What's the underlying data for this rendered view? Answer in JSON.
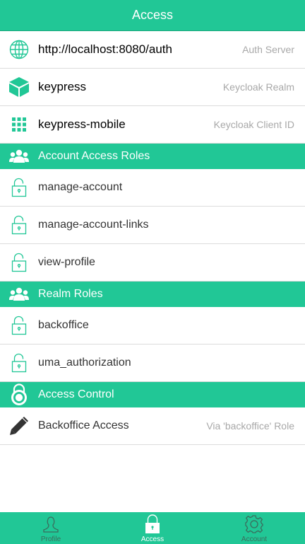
{
  "navbar": {
    "title": "Access"
  },
  "server": {
    "value": "http://localhost:8080/auth",
    "detail": "Auth Server"
  },
  "realm": {
    "value": "keypress",
    "detail": "Keycloak Realm"
  },
  "client": {
    "value": "keypress-mobile",
    "detail": "Keycloak Client ID"
  },
  "sections": {
    "account_roles": "Account Access Roles",
    "realm_roles": "Realm Roles",
    "access_control": "Access Control"
  },
  "account_roles": [
    "manage-account",
    "manage-account-links",
    "view-profile"
  ],
  "realm_roles": [
    "backoffice",
    "uma_authorization"
  ],
  "access_control": {
    "label": "Backoffice Access",
    "detail": "Via 'backoffice' Role"
  },
  "tabs": [
    {
      "label": "Profile",
      "icon": "person-icon",
      "active": false
    },
    {
      "label": "Access",
      "icon": "lock-icon",
      "active": true
    },
    {
      "label": "Account",
      "icon": "gear-icon",
      "active": false
    }
  ],
  "colors": {
    "accent": "#21c796",
    "detail_text": "#a8a8a8",
    "divider": "#dcdcdc"
  }
}
